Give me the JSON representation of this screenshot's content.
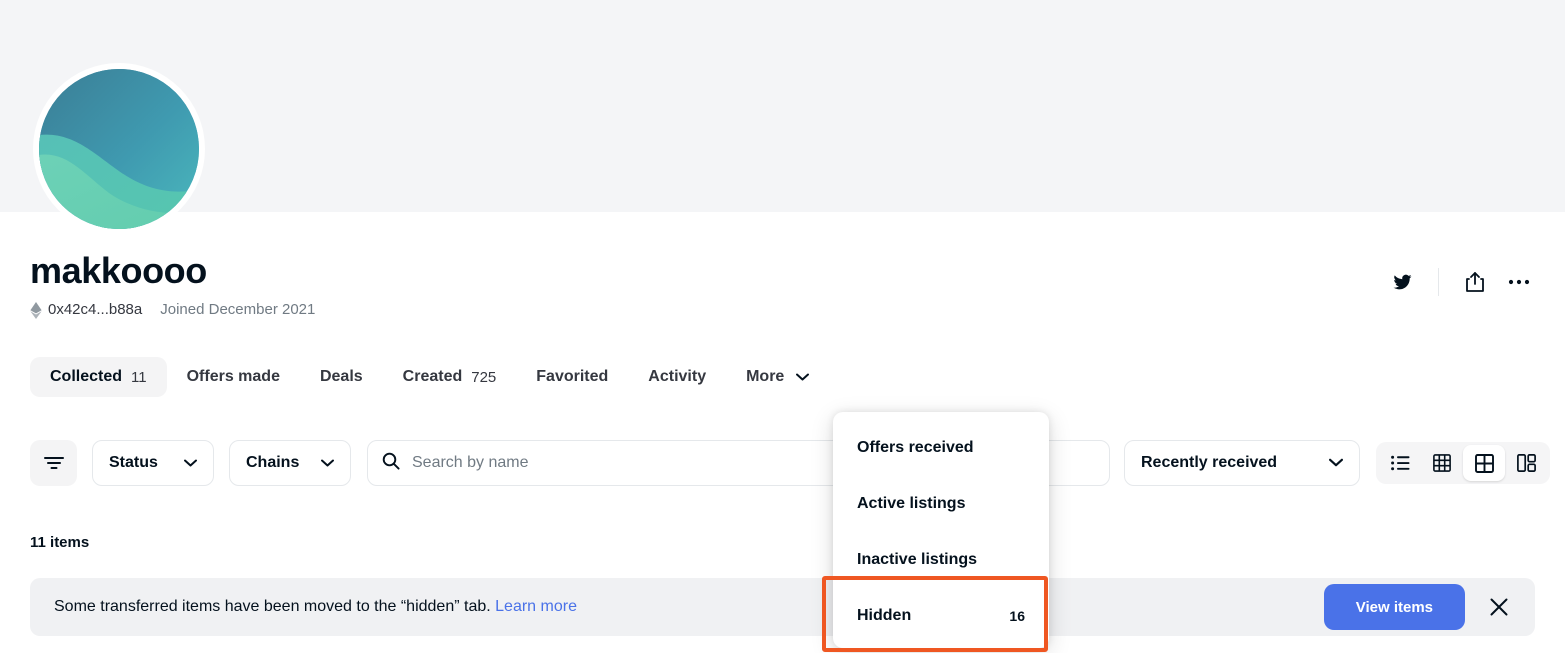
{
  "profile": {
    "username": "makkoooo",
    "address": "0x42c4...b88a",
    "joined": "Joined December 2021",
    "eth_icon": "ethereum-icon",
    "avatar_alt": "profile-avatar"
  },
  "header_actions": [
    {
      "name": "twitter-icon",
      "label": "Twitter"
    },
    {
      "name": "share-icon",
      "label": "Share"
    },
    {
      "name": "more-options-icon",
      "label": "More options"
    }
  ],
  "tabs": [
    {
      "label": "Collected",
      "count": "11",
      "active": true
    },
    {
      "label": "Offers made",
      "count": "",
      "active": false
    },
    {
      "label": "Deals",
      "count": "",
      "active": false
    },
    {
      "label": "Created",
      "count": "725",
      "active": false
    },
    {
      "label": "Favorited",
      "count": "",
      "active": false
    },
    {
      "label": "Activity",
      "count": "",
      "active": false
    },
    {
      "label": "More",
      "count": "",
      "active": false,
      "has_caret": true
    }
  ],
  "more_menu": {
    "open": true,
    "items": [
      {
        "label": "Offers received",
        "count": ""
      },
      {
        "label": "Active listings",
        "count": ""
      },
      {
        "label": "Inactive listings",
        "count": ""
      },
      {
        "label": "Hidden",
        "count": "16",
        "highlighted": true
      }
    ],
    "highlight_color": "#ef5722"
  },
  "filters": {
    "filter_icon": "filter-icon",
    "status_label": "Status",
    "chains_label": "Chains",
    "search_placeholder": "Search by name",
    "search_value": "",
    "sort_label": "Recently received",
    "view_modes": [
      {
        "name": "list-view-icon",
        "selected": false
      },
      {
        "name": "dense-grid-view-icon",
        "selected": false
      },
      {
        "name": "grid-view-icon",
        "selected": true
      },
      {
        "name": "split-view-icon",
        "selected": false
      }
    ]
  },
  "results": {
    "items_count": "11 items"
  },
  "notice": {
    "message": "Some transferred items have been moved to the “hidden” tab.",
    "link_label": "Learn more",
    "button_label": "View items",
    "close_icon": "close-icon",
    "button_color": "#4a72e8"
  }
}
